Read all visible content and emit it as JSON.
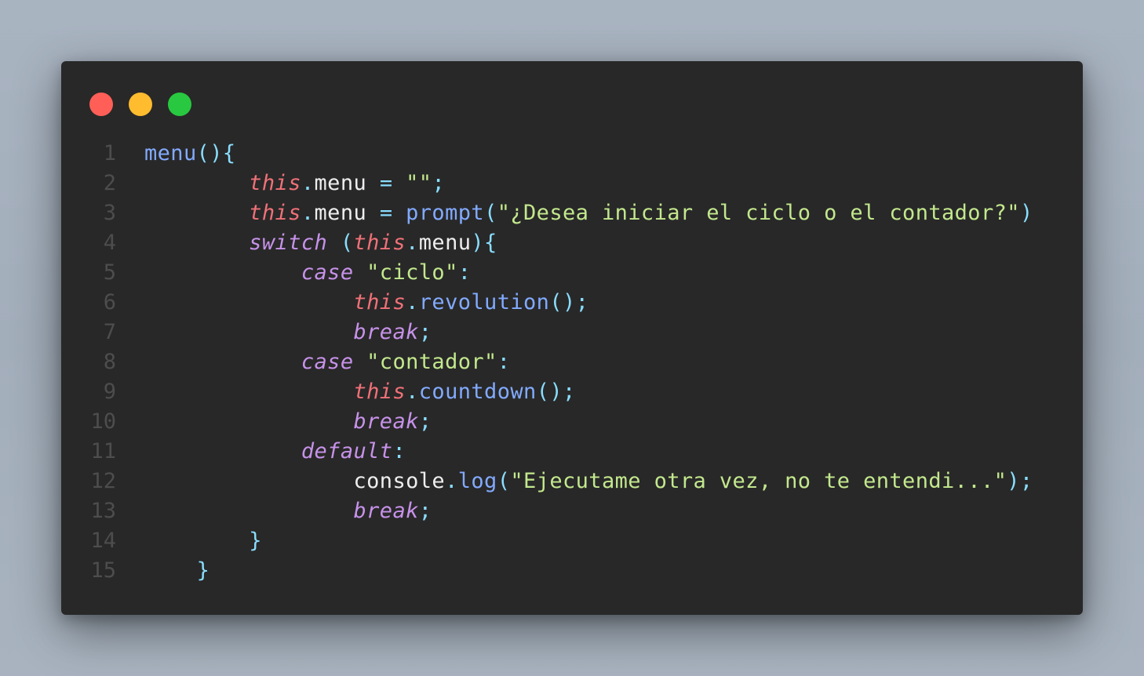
{
  "window": {
    "controls": [
      {
        "name": "close",
        "color": "#ff5f57"
      },
      {
        "name": "minimize",
        "color": "#febc2e"
      },
      {
        "name": "maximize",
        "color": "#28c840"
      }
    ]
  },
  "theme": {
    "background": "#282828",
    "line_number": "#4d4d4d",
    "default": "#eeeeee",
    "function": "#82aaff",
    "punctuation": "#89ddff",
    "this_keyword": "#f07178",
    "control_keyword": "#c792ea",
    "string": "#c3e88d"
  },
  "code": {
    "lines": [
      {
        "n": "1",
        "tokens": [
          {
            "t": "menu",
            "c": "fn"
          },
          {
            "t": "(){",
            "c": "p"
          }
        ]
      },
      {
        "n": "2",
        "tokens": [
          {
            "t": "        "
          },
          {
            "t": "this",
            "c": "th"
          },
          {
            "t": ".",
            "c": "p"
          },
          {
            "t": "menu",
            "c": "d"
          },
          {
            "t": " "
          },
          {
            "t": "=",
            "c": "p"
          },
          {
            "t": " "
          },
          {
            "t": "\"\"",
            "c": "s"
          },
          {
            "t": ";",
            "c": "p"
          }
        ]
      },
      {
        "n": "3",
        "tokens": [
          {
            "t": "        "
          },
          {
            "t": "this",
            "c": "th"
          },
          {
            "t": ".",
            "c": "p"
          },
          {
            "t": "menu",
            "c": "d"
          },
          {
            "t": " "
          },
          {
            "t": "=",
            "c": "p"
          },
          {
            "t": " "
          },
          {
            "t": "prompt",
            "c": "fn"
          },
          {
            "t": "(",
            "c": "p"
          },
          {
            "t": "\"¿Desea iniciar el ciclo o el contador?\"",
            "c": "s"
          },
          {
            "t": ")",
            "c": "p"
          }
        ]
      },
      {
        "n": "4",
        "tokens": [
          {
            "t": "        "
          },
          {
            "t": "switch",
            "c": "kw"
          },
          {
            "t": " "
          },
          {
            "t": "(",
            "c": "p"
          },
          {
            "t": "this",
            "c": "th"
          },
          {
            "t": ".",
            "c": "p"
          },
          {
            "t": "menu",
            "c": "d"
          },
          {
            "t": "){",
            "c": "p"
          }
        ]
      },
      {
        "n": "5",
        "tokens": [
          {
            "t": "            "
          },
          {
            "t": "case",
            "c": "kw"
          },
          {
            "t": " "
          },
          {
            "t": "\"ciclo\"",
            "c": "s"
          },
          {
            "t": ":",
            "c": "p"
          }
        ]
      },
      {
        "n": "6",
        "tokens": [
          {
            "t": "                "
          },
          {
            "t": "this",
            "c": "th"
          },
          {
            "t": ".",
            "c": "p"
          },
          {
            "t": "revolution",
            "c": "fn"
          },
          {
            "t": "();",
            "c": "p"
          }
        ]
      },
      {
        "n": "7",
        "tokens": [
          {
            "t": "                "
          },
          {
            "t": "break",
            "c": "kw"
          },
          {
            "t": ";",
            "c": "p"
          }
        ]
      },
      {
        "n": "8",
        "tokens": [
          {
            "t": "            "
          },
          {
            "t": "case",
            "c": "kw"
          },
          {
            "t": " "
          },
          {
            "t": "\"contador\"",
            "c": "s"
          },
          {
            "t": ":",
            "c": "p"
          }
        ]
      },
      {
        "n": "9",
        "tokens": [
          {
            "t": "                "
          },
          {
            "t": "this",
            "c": "th"
          },
          {
            "t": ".",
            "c": "p"
          },
          {
            "t": "countdown",
            "c": "fn"
          },
          {
            "t": "();",
            "c": "p"
          }
        ]
      },
      {
        "n": "10",
        "tokens": [
          {
            "t": "                "
          },
          {
            "t": "break",
            "c": "kw"
          },
          {
            "t": ";",
            "c": "p"
          }
        ]
      },
      {
        "n": "11",
        "tokens": [
          {
            "t": "            "
          },
          {
            "t": "default",
            "c": "kw"
          },
          {
            "t": ":",
            "c": "p"
          }
        ]
      },
      {
        "n": "12",
        "tokens": [
          {
            "t": "                "
          },
          {
            "t": "console",
            "c": "d"
          },
          {
            "t": ".",
            "c": "p"
          },
          {
            "t": "log",
            "c": "fn"
          },
          {
            "t": "(",
            "c": "p"
          },
          {
            "t": "\"Ejecutame otra vez, no te entendi...\"",
            "c": "s"
          },
          {
            "t": ");",
            "c": "p"
          }
        ]
      },
      {
        "n": "13",
        "tokens": [
          {
            "t": "                "
          },
          {
            "t": "break",
            "c": "kw"
          },
          {
            "t": ";",
            "c": "p"
          }
        ]
      },
      {
        "n": "14",
        "tokens": [
          {
            "t": "        "
          },
          {
            "t": "}",
            "c": "p"
          }
        ]
      },
      {
        "n": "15",
        "tokens": [
          {
            "t": "    "
          },
          {
            "t": "}",
            "c": "p"
          }
        ]
      }
    ]
  }
}
